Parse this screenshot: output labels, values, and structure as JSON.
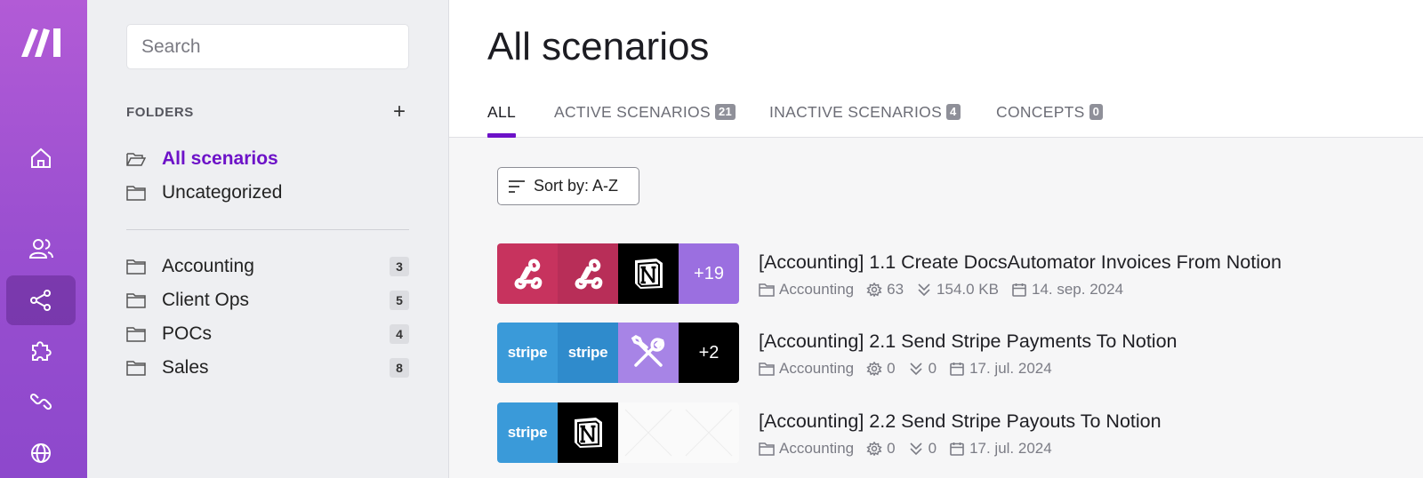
{
  "sidebar": {
    "nav": [
      {
        "icon": "home-icon"
      },
      {
        "icon": "users-icon"
      },
      {
        "icon": "share-icon",
        "active": true
      },
      {
        "icon": "puzzle-icon"
      },
      {
        "icon": "link-icon"
      },
      {
        "icon": "globe-icon"
      }
    ]
  },
  "folders": {
    "search_placeholder": "Search",
    "header": "FOLDERS",
    "add_label": "+",
    "top": [
      {
        "name": "All scenarios",
        "active": true
      },
      {
        "name": "Uncategorized"
      }
    ],
    "list": [
      {
        "name": "Accounting",
        "count": "3"
      },
      {
        "name": "Client Ops",
        "count": "5"
      },
      {
        "name": "POCs",
        "count": "4"
      },
      {
        "name": "Sales",
        "count": "8"
      }
    ]
  },
  "main": {
    "title": "All scenarios",
    "tabs": [
      {
        "label": "ALL"
      },
      {
        "label": "ACTIVE SCENARIOS",
        "badge": "21"
      },
      {
        "label": "INACTIVE SCENARIOS",
        "badge": "4"
      },
      {
        "label": "CONCEPTS",
        "badge": "0"
      }
    ],
    "sort_label": "Sort by: A-Z",
    "scenarios": [
      {
        "name": "[Accounting] 1.1 Create DocsAutomator Invoices From Notion",
        "folder": "Accounting",
        "ops": "63",
        "size": "154.0 KB",
        "date": "14. sep. 2024",
        "tiles": [
          {
            "kind": "webhook",
            "color": "#c7335e"
          },
          {
            "kind": "webhook",
            "color": "#b82e58"
          },
          {
            "kind": "notion",
            "color": "#000000"
          },
          {
            "kind": "more",
            "label": "+19",
            "color": "#9b6fe0"
          }
        ]
      },
      {
        "name": "[Accounting] 2.1 Send Stripe Payments To Notion",
        "folder": "Accounting",
        "ops": "0",
        "size": "0",
        "date": "17. jul. 2024",
        "tiles": [
          {
            "kind": "stripe",
            "label": "stripe",
            "color": "#3a9ad9"
          },
          {
            "kind": "stripe",
            "label": "stripe",
            "color": "#2f8bcc"
          },
          {
            "kind": "tools",
            "color": "#a784e6"
          },
          {
            "kind": "more",
            "label": "+2",
            "color": "#000000"
          }
        ]
      },
      {
        "name": "[Accounting] 2.2 Send Stripe Payouts To Notion",
        "folder": "Accounting",
        "ops": "0",
        "size": "0",
        "date": "17. jul. 2024",
        "tiles": [
          {
            "kind": "stripe",
            "label": "stripe",
            "color": "#3a9ad9"
          },
          {
            "kind": "notion",
            "color": "#000000"
          },
          {
            "kind": "empty",
            "color": "#fafafa"
          },
          {
            "kind": "empty",
            "color": "#fafafa"
          }
        ]
      }
    ]
  }
}
